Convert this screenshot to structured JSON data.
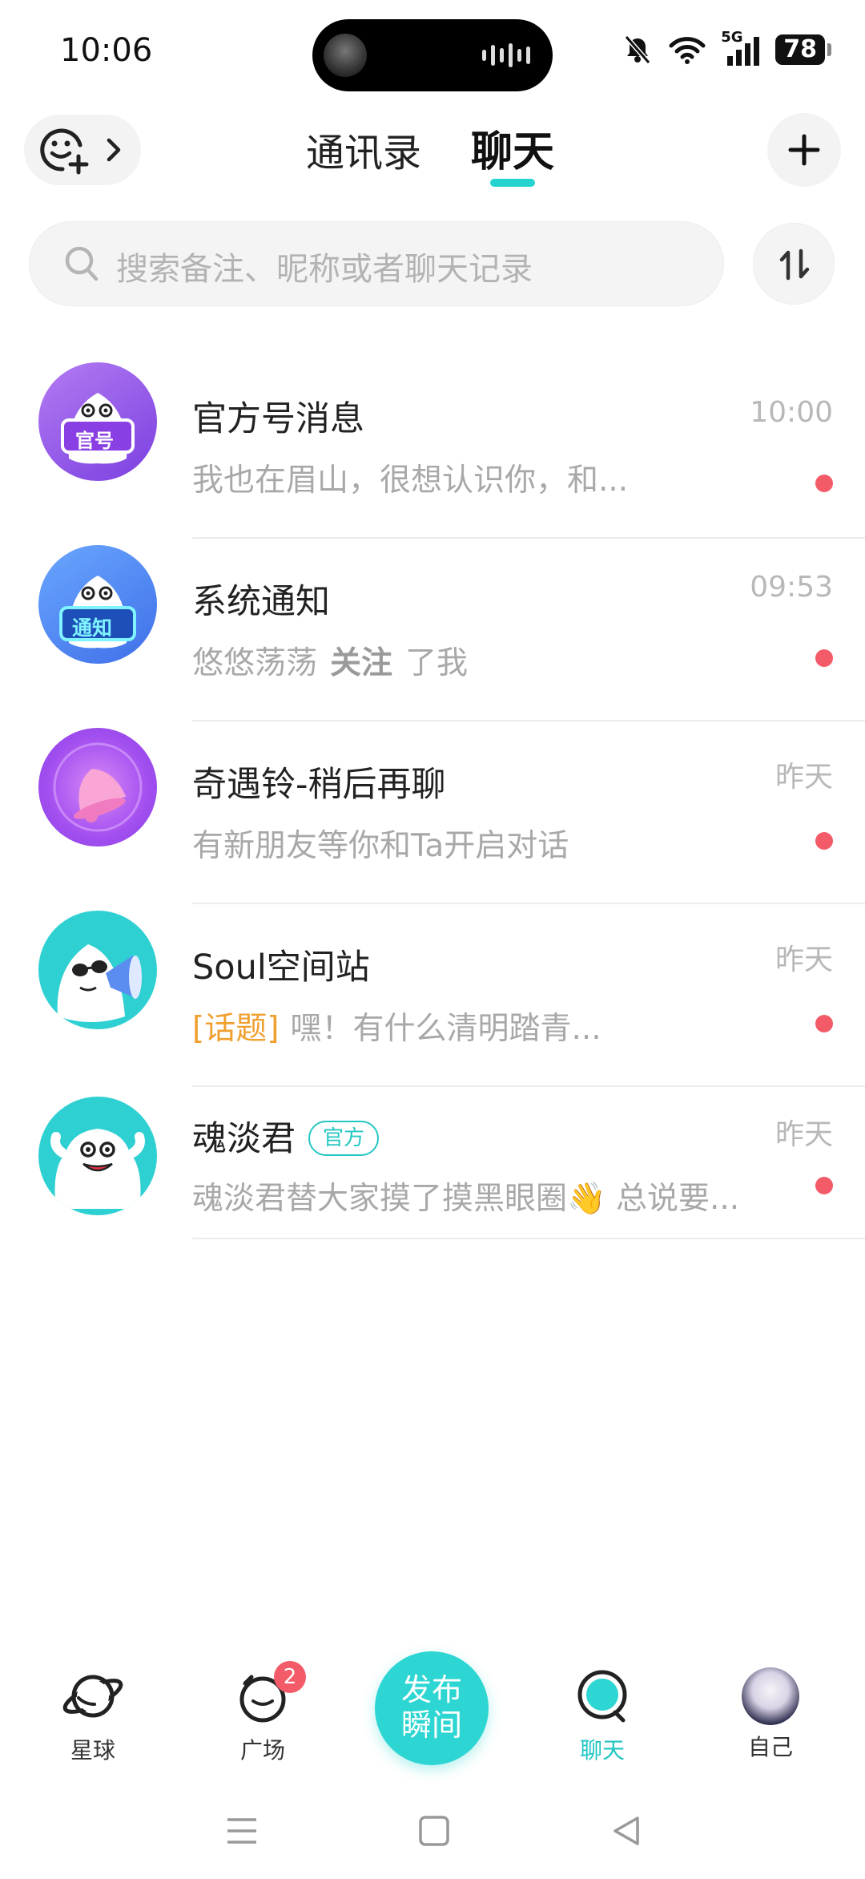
{
  "status_bar": {
    "time": "10:06",
    "battery": "78",
    "network": "5G",
    "icons": [
      "bell-muted-icon",
      "wifi-icon",
      "signal-icon",
      "battery-icon"
    ]
  },
  "header": {
    "tabs": [
      {
        "label": "通讯录",
        "active": false
      },
      {
        "label": "聊天",
        "active": true
      }
    ],
    "left_icon": "smiley-plus-icon",
    "right_icon": "plus-icon"
  },
  "search": {
    "placeholder": "搜索备注、昵称或者聊天记录",
    "sort_icon": "sort-arrows-icon"
  },
  "chats": [
    {
      "name": "官方号消息",
      "preview": "我也在眉山，很想认识你，和...",
      "time": "10:00",
      "unread": true,
      "avatar": "ghost-official-avatar",
      "avatar_text": "官号"
    },
    {
      "name": "系统通知",
      "preview_prefix": "悠悠荡荡",
      "preview_emphasis": "关注",
      "preview_suffix": "了我",
      "time": "09:53",
      "unread": true,
      "avatar": "ghost-notice-avatar",
      "avatar_text": "通知"
    },
    {
      "name": "奇遇铃-稍后再聊",
      "preview": "有新朋友等你和Ta开启对话",
      "time": "昨天",
      "unread": true,
      "avatar": "bell-avatar"
    },
    {
      "name": "Soul空间站",
      "preview_topic": "[话题]",
      "preview": "嘿！有什么清明踏青...",
      "time": "昨天",
      "unread": true,
      "avatar": "ghost-megaphone-avatar"
    },
    {
      "name": "魂淡君",
      "badge": "官方",
      "preview": "魂淡君替大家摸了摸黑眼圈👋 总说要...",
      "time": "昨天",
      "unread": true,
      "avatar": "ghost-smile-avatar"
    }
  ],
  "bottom_nav": {
    "items": [
      {
        "label": "星球",
        "icon": "planet-icon",
        "active": false
      },
      {
        "label": "广场",
        "icon": "square-icon",
        "active": false,
        "badge": "2"
      },
      {
        "label": "聊天",
        "icon": "chat-bubble-icon",
        "active": true
      },
      {
        "label": "自己",
        "icon": "profile-avatar",
        "active": false
      }
    ],
    "publish": {
      "line1": "发布",
      "line2": "瞬间"
    }
  },
  "colors": {
    "accent": "#25d4d0",
    "unread": "#f45b69",
    "topic": "#f0a030"
  }
}
